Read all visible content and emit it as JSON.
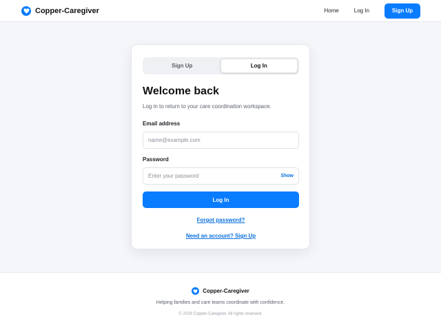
{
  "header": {
    "brand_name": "Copper-Caregiver",
    "nav": {
      "home": "Home",
      "login": "Log In",
      "signup": "Sign Up"
    }
  },
  "card": {
    "tabs": [
      {
        "label": "Sign Up",
        "active": false
      },
      {
        "label": "Log In",
        "active": true
      }
    ],
    "title": "Welcome back",
    "subtitle": "Log in to return to your care coordination workspace.",
    "email": {
      "label": "Email address",
      "placeholder": "name@example.com",
      "value": ""
    },
    "password": {
      "label": "Password",
      "placeholder": "Enter your password",
      "value": "",
      "toggle_label": "Show"
    },
    "submit_label": "Log In",
    "forgot_link": "Forgot password?",
    "signup_link": "Need an account? Sign Up"
  },
  "footer": {
    "brand_name": "Copper-Caregiver",
    "tagline": "Helping families and care teams coordinate with confidence.",
    "copyright": "© 2026 Copper-Caregiver. All rights reserved."
  },
  "icons": {
    "logo": "heart-icon"
  },
  "colors": {
    "accent": "#0a7cff",
    "link": "#0a6fe0",
    "background": "#f4f6f9"
  }
}
